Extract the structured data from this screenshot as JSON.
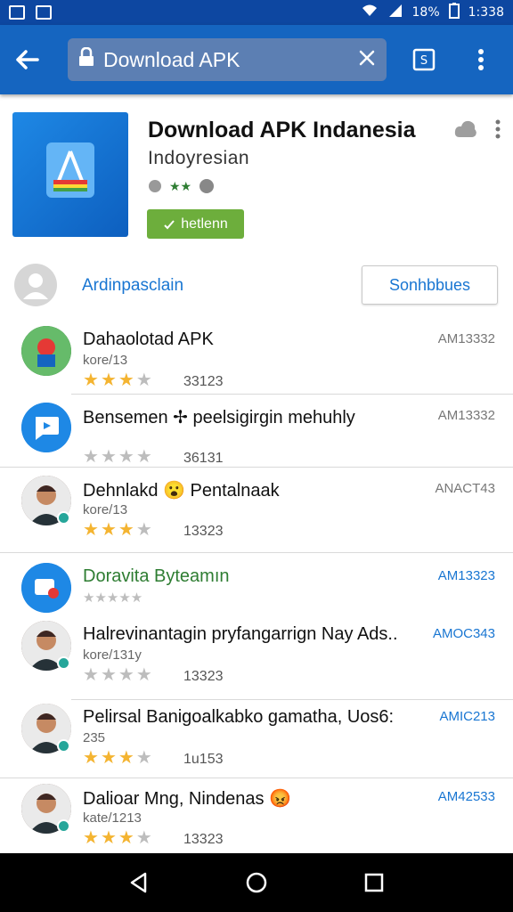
{
  "status": {
    "battery": "18%",
    "time": "1:338"
  },
  "toolbar": {
    "url": "Download APK"
  },
  "app": {
    "title": "Download APK Indanesia",
    "developer": "Indoyresian",
    "meta": "★★",
    "install_label": "hetlenn"
  },
  "author": {
    "name": "Ardinpasclain",
    "subscribe_label": "Sonhbbues"
  },
  "items": [
    {
      "name": "Dahaolotad APK",
      "sub": "kore/13",
      "stars": 3,
      "count": "33123",
      "time": "AM13332",
      "avatar": "app-icon"
    },
    {
      "name": "Bensemen ✢ peelsigirgin mehuhly",
      "sub": "",
      "stars": 0,
      "count": "36131",
      "time": "AM13332",
      "avatar": "chat-icon"
    },
    {
      "name": "Dehnlakd 😮 Pentalnaak",
      "sub": "kore/13",
      "stars": 3,
      "count": "13323",
      "time": "ANACT43",
      "avatar": "person"
    },
    {
      "name": "Doravita Byteamın",
      "sub": "★★★★★",
      "stars": -1,
      "count": "",
      "time": "AM13323",
      "avatar": "logo"
    },
    {
      "name": "Halrevinantagin pryfangarrign Nay Ads..",
      "sub": "kore/131y",
      "stars": 0,
      "count": "13323",
      "time": "AMOC343",
      "avatar": "person"
    },
    {
      "name": "Pelirsal Banigoalkabko gamatha, Uos6:",
      "sub": "235",
      "stars": 3,
      "count": "1u153",
      "time": "AMIC213",
      "avatar": "person-f"
    },
    {
      "name": "Dalioar Mng, Nindenas 😡",
      "sub": "kate/1213",
      "stars": 3,
      "count": "13323",
      "time": "AM42533",
      "avatar": "person"
    }
  ],
  "colors": {
    "primary": "#1565c0",
    "status": "#0d47a1",
    "accent": "#1976d2",
    "star": "#f4b431",
    "install": "#6dae3c"
  }
}
